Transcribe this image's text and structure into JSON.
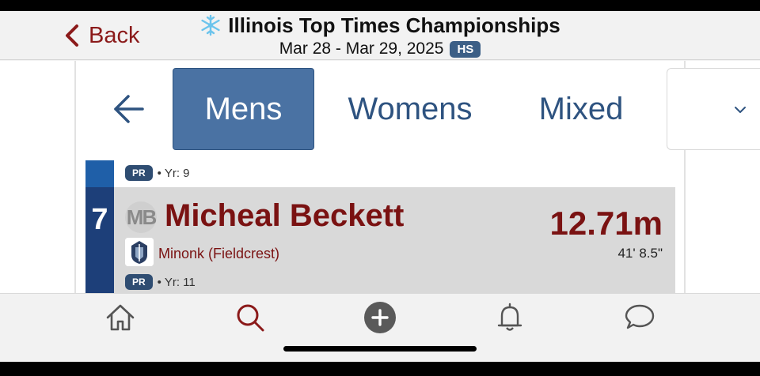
{
  "header": {
    "back_label": "Back",
    "title": "Illinois Top Times Championships",
    "dates": "Mar 28 - Mar 29, 2025",
    "level_badge": "HS",
    "icon": "snowflake-icon"
  },
  "tabs": [
    {
      "label": "Mens",
      "active": true
    },
    {
      "label": "Womens",
      "active": false
    },
    {
      "label": "Mixed",
      "active": false
    }
  ],
  "results": {
    "previous": {
      "badge": "PR",
      "meta": "• Yr: 9"
    },
    "current": {
      "place": "7",
      "avatar_initials": "MB",
      "name": "Micheal Beckett",
      "team": "Minonk (Fieldcrest)",
      "mark_metric": "12.71m",
      "mark_imperial": "41' 8.5\"",
      "badge": "PR",
      "meta": "• Yr: 11"
    }
  },
  "tabbar": {
    "items": [
      "home-icon",
      "search-icon",
      "add-icon",
      "bell-icon",
      "chat-icon"
    ],
    "active": "search-icon"
  },
  "colors": {
    "accent_red": "#7a1212",
    "accent_blue": "#4a72a3",
    "rank_bar": "#1d3f79"
  }
}
